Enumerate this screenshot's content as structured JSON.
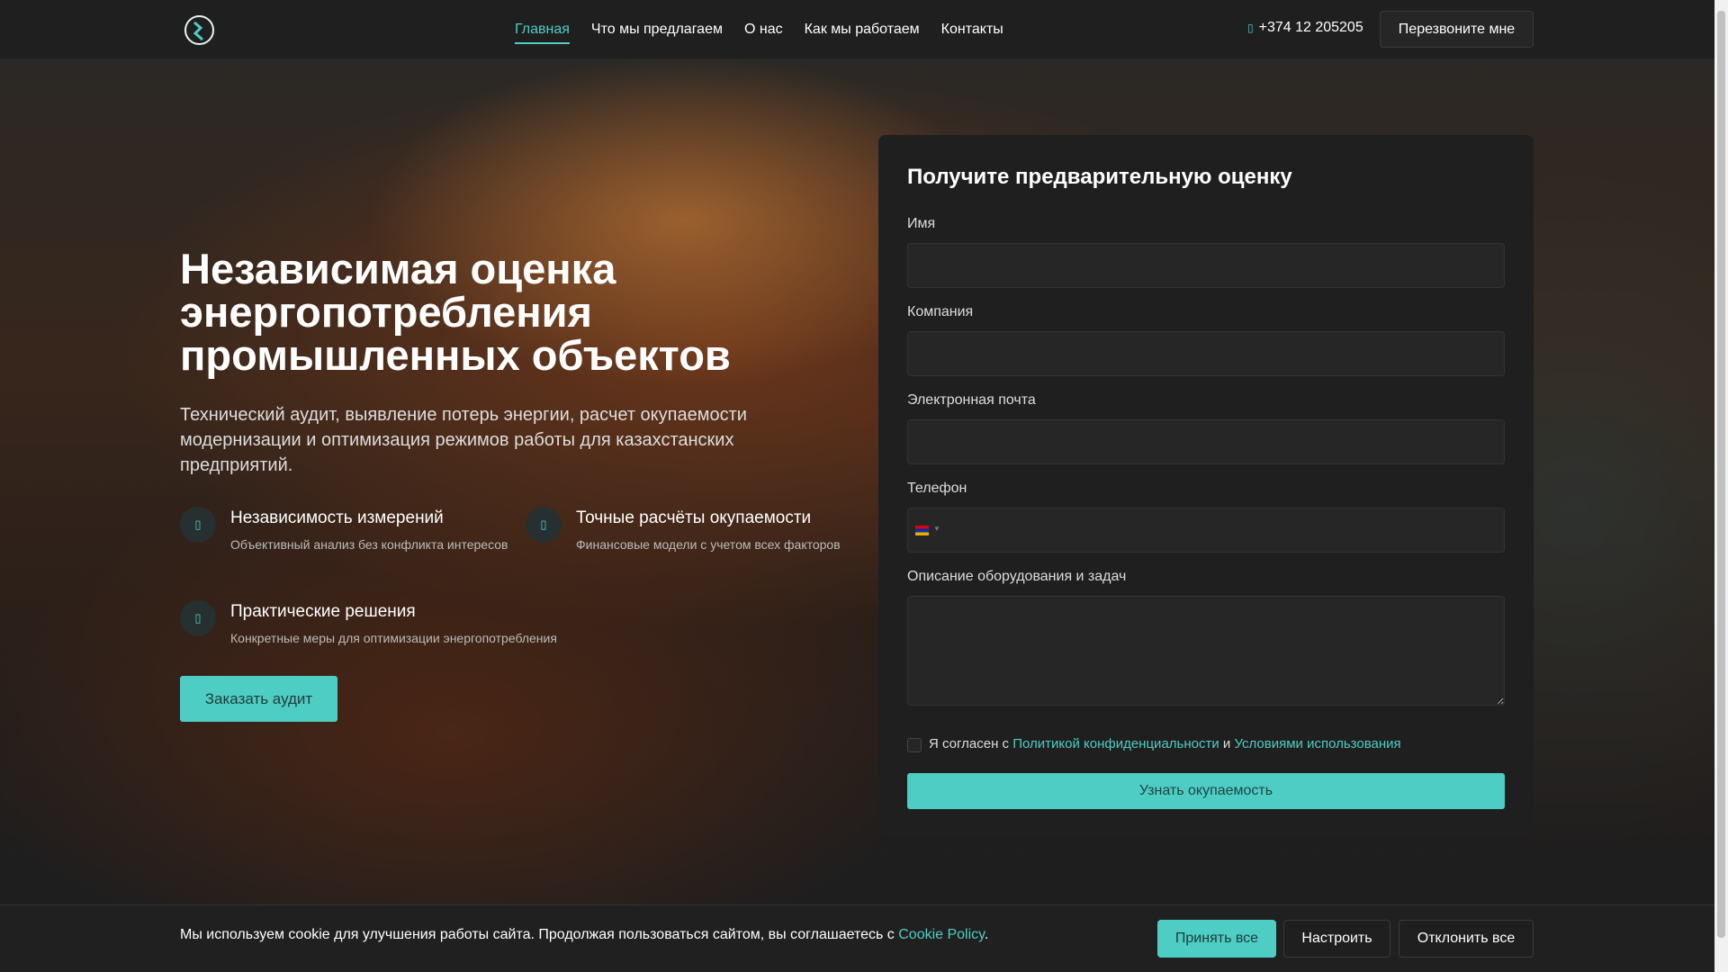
{
  "header": {
    "nav": [
      "Главная",
      "Что мы предлагаем",
      "О нас",
      "Как мы работаем",
      "Контакты"
    ],
    "phone_icon": "phone-icon",
    "phone": "+374 12 205205",
    "callback": "Перезвоните мне"
  },
  "hero": {
    "title": "Независимая оценка энергопотребления промышленных объектов",
    "subtitle": "Технический аудит, выявление потерь энергии, расчет окупаемости модернизации и оптимизация режимов работы для казахстанских предприятий.",
    "features": [
      {
        "title": "Независимость измерений",
        "desc": "Объективный анализ без конфликта интересов"
      },
      {
        "title": "Точные расчёты окупаемости",
        "desc": "Финансовые модели с учетом всех факторов"
      },
      {
        "title": "Практические решения",
        "desc": "Конкретные меры для оптимизации энергопотребления"
      }
    ],
    "cta": "Заказать аудит"
  },
  "form": {
    "title": "Получите предварительную оценку",
    "name": "Имя",
    "company": "Компания",
    "email": "Электронная почта",
    "phone": "Телефон",
    "desc": "Описание оборудования и задач",
    "agree_pre": "Я согласен с",
    "privacy": "Политикой конфиденциальности",
    "and": "и",
    "terms": "Условиями использования",
    "submit": "Узнать окупаемость"
  },
  "cookie": {
    "text": "Мы используем cookie для улучшения работы сайта. Продолжая пользоваться сайтом, вы соглашаетесь с",
    "policy": "Cookie Policy",
    "accept": "Принять все",
    "settings": "Настроить",
    "reject": "Отклонить все"
  },
  "colors": {
    "accent": "#4ecdc4",
    "surface": "#1f1f1f"
  }
}
